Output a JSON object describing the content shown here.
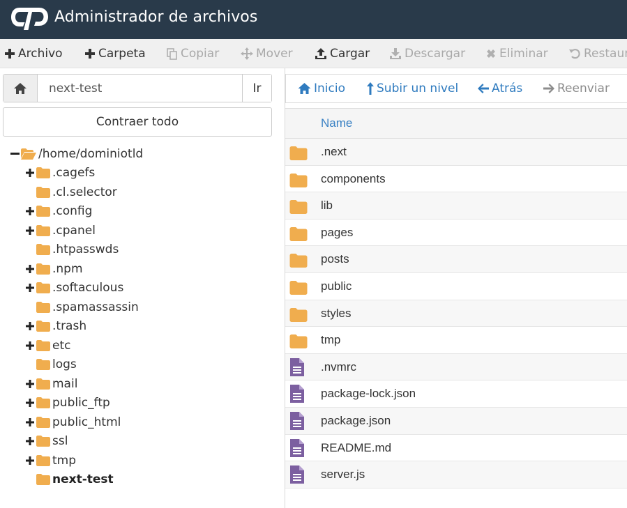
{
  "header": {
    "title": "Administrador de archivos"
  },
  "toolbar": {
    "file": "Archivo",
    "folder": "Carpeta",
    "copy": "Copiar",
    "move": "Mover",
    "upload": "Cargar",
    "download": "Descargar",
    "delete": "Eliminar",
    "restore": "Restaurar"
  },
  "pathbar": {
    "value": "next-test",
    "go": "Ir"
  },
  "tree": {
    "collapse_label": "Contraer todo",
    "root": "/home/dominiotld",
    "items": [
      {
        "label": ".cagefs",
        "expandable": true
      },
      {
        "label": ".cl.selector",
        "expandable": false
      },
      {
        "label": ".config",
        "expandable": true
      },
      {
        "label": ".cpanel",
        "expandable": true
      },
      {
        "label": ".htpasswds",
        "expandable": false
      },
      {
        "label": ".npm",
        "expandable": true
      },
      {
        "label": ".softaculous",
        "expandable": true
      },
      {
        "label": ".spamassassin",
        "expandable": false
      },
      {
        "label": ".trash",
        "expandable": true
      },
      {
        "label": "etc",
        "expandable": true
      },
      {
        "label": "logs",
        "expandable": false
      },
      {
        "label": "mail",
        "expandable": true
      },
      {
        "label": "public_ftp",
        "expandable": true
      },
      {
        "label": "public_html",
        "expandable": true
      },
      {
        "label": "ssl",
        "expandable": true
      },
      {
        "label": "tmp",
        "expandable": true
      },
      {
        "label": "next-test",
        "expandable": false,
        "current": true
      }
    ]
  },
  "nav": {
    "home": "Inicio",
    "up": "Subir un nivel",
    "back": "Atrás",
    "forward": "Reenviar"
  },
  "table": {
    "header_name": "Name",
    "rows": [
      {
        "name": ".next",
        "type": "folder"
      },
      {
        "name": "components",
        "type": "folder"
      },
      {
        "name": "lib",
        "type": "folder"
      },
      {
        "name": "pages",
        "type": "folder"
      },
      {
        "name": "posts",
        "type": "folder"
      },
      {
        "name": "public",
        "type": "folder"
      },
      {
        "name": "styles",
        "type": "folder"
      },
      {
        "name": "tmp",
        "type": "folder"
      },
      {
        "name": ".nvmrc",
        "type": "file"
      },
      {
        "name": "package-lock.json",
        "type": "file"
      },
      {
        "name": "package.json",
        "type": "file"
      },
      {
        "name": "README.md",
        "type": "file"
      },
      {
        "name": "server.js",
        "type": "file"
      }
    ]
  },
  "colors": {
    "header_bg": "#293a4a",
    "folder": "#f0ad4e",
    "file": "#7c5fa0",
    "link": "#2f7bbf"
  }
}
